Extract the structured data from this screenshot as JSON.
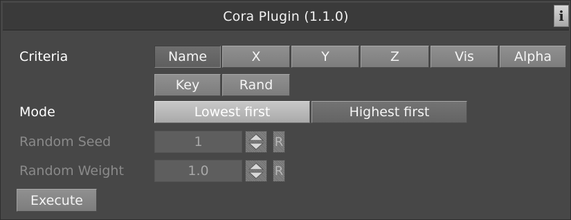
{
  "window": {
    "title": "Cora Plugin (1.1.0)",
    "info_label": "i"
  },
  "criteria": {
    "label": "Criteria",
    "options": [
      "Name",
      "X",
      "Y",
      "Z",
      "Vis",
      "Alpha",
      "Key",
      "Rand"
    ],
    "selected": "Name"
  },
  "mode": {
    "label": "Mode",
    "options": [
      "Lowest first",
      "Highest first"
    ],
    "selected": "Lowest first"
  },
  "random_seed": {
    "label": "Random Seed",
    "value": "1",
    "reset_label": "R"
  },
  "random_weight": {
    "label": "Random Weight",
    "value": "1.0",
    "reset_label": "R"
  },
  "execute_label": "Execute",
  "icons": {
    "spinner": "up-down-spinner-icon",
    "info": "info-icon"
  }
}
